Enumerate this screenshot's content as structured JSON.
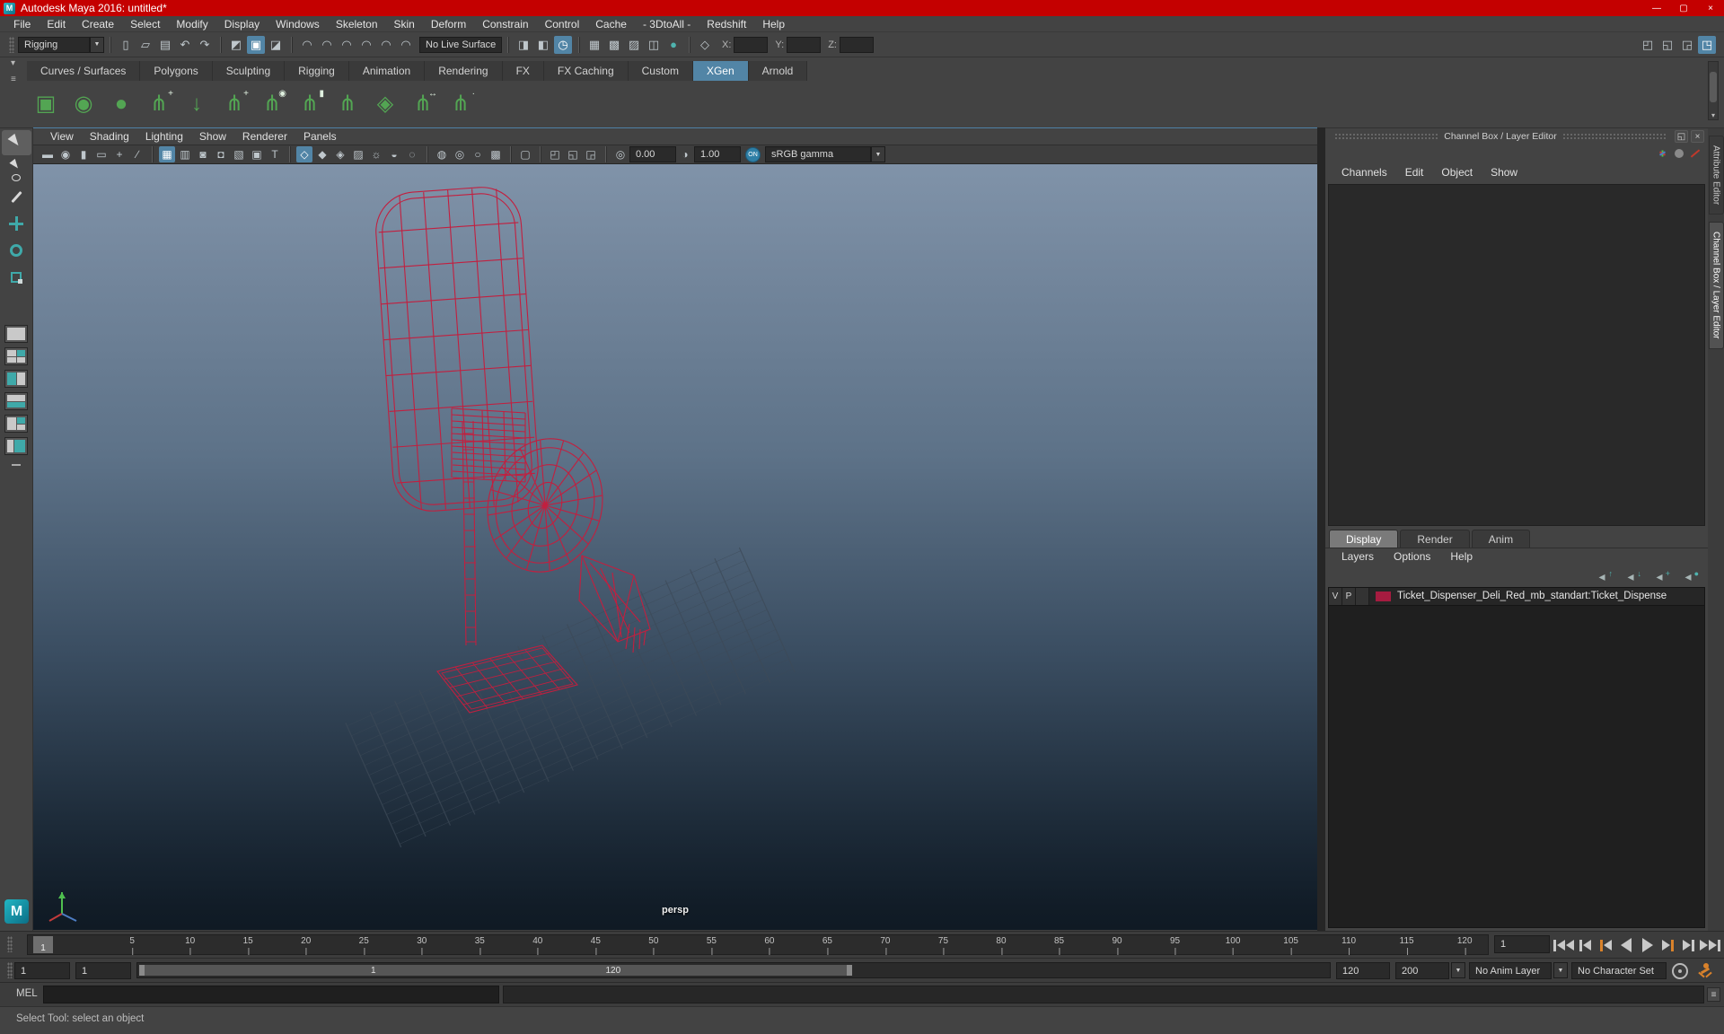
{
  "window": {
    "title": "Autodesk Maya 2016: untitled*",
    "controls": {
      "minimize": "—",
      "maximize": "▢",
      "close": "×"
    }
  },
  "icons": {
    "maya_logo": "M",
    "dropdown": "▼",
    "small_arrow": "▾",
    "shelf_menu": "≡",
    "float_window": "◱",
    "close_window": "×",
    "exposure": "◎",
    "contrast": "◑",
    "script_editor": "≡"
  },
  "menu_bar": {
    "items": [
      "File",
      "Edit",
      "Create",
      "Select",
      "Modify",
      "Display",
      "Windows",
      "Skeleton",
      "Skin",
      "Deform",
      "Constrain",
      "Control",
      "Cache",
      "- 3DtoAll -",
      "Redshift",
      "Help"
    ]
  },
  "status_line": {
    "menu_set": "Rigging",
    "live_surface_label": "No Live Surface",
    "axis_labels": {
      "x": "X:",
      "y": "Y:",
      "z": "Z:"
    },
    "icons_a": [
      {
        "n": "new-scene-icon",
        "g": "▯"
      },
      {
        "n": "open-scene-icon",
        "g": "▱"
      },
      {
        "n": "save-scene-icon",
        "g": "▤"
      },
      {
        "n": "undo-icon",
        "g": "↶"
      },
      {
        "n": "redo-icon",
        "g": "↷"
      },
      {
        "sep": true
      },
      {
        "n": "select-hierarchy-mode-icon",
        "g": "◩"
      },
      {
        "n": "select-object-mode-icon",
        "g": "▣",
        "active": true
      },
      {
        "n": "select-component-mode-icon",
        "g": "◪"
      },
      {
        "sep": true
      },
      {
        "n": "snap-to-grid-icon",
        "g": "◠"
      },
      {
        "n": "snap-to-curves-icon",
        "g": "◠"
      },
      {
        "n": "snap-to-points-icon",
        "g": "◠"
      },
      {
        "n": "snap-to-projected-center-icon",
        "g": "◠"
      },
      {
        "n": "snap-to-view-plane-icon",
        "g": "◠"
      },
      {
        "n": "make-live-icon",
        "g": "◠"
      }
    ],
    "icons_b": [
      {
        "sep": true
      },
      {
        "n": "input-connections-icon",
        "g": "◨"
      },
      {
        "n": "output-connections-icon",
        "g": "◧"
      },
      {
        "n": "construction-history-icon",
        "g": "◷",
        "active": true
      },
      {
        "sep": true
      },
      {
        "n": "render-current-frame-icon",
        "g": "▦"
      },
      {
        "n": "ipr-render-icon",
        "g": "▩"
      },
      {
        "n": "render-settings-icon",
        "g": "▨"
      },
      {
        "n": "hypershade-icon",
        "g": "◫"
      },
      {
        "n": "launch-render-view-icon",
        "g": "●",
        "teal": true
      },
      {
        "sep": true
      },
      {
        "n": "symmetry-icon",
        "g": "◇"
      }
    ],
    "icons_right": [
      {
        "n": "modeling-toolkit-icon",
        "g": "◰"
      },
      {
        "n": "attribute-editor-toggle-icon",
        "g": "◱"
      },
      {
        "n": "tool-settings-toggle-icon",
        "g": "◲"
      },
      {
        "n": "channel-box-toggle-icon",
        "g": "◳",
        "active": true
      }
    ]
  },
  "shelf": {
    "tabs": [
      "Curves / Surfaces",
      "Polygons",
      "Sculpting",
      "Rigging",
      "Animation",
      "Rendering",
      "FX",
      "FX Caching",
      "Custom",
      "XGen",
      "Arnold"
    ],
    "active_tab": "XGen",
    "icons": [
      {
        "n": "xgen-editor-icon",
        "g": "▣"
      },
      {
        "n": "xgen-update-preview-icon",
        "g": "◉"
      },
      {
        "n": "xgen-create-description-icon",
        "g": "●"
      },
      {
        "n": "xgen-add-collection-icon",
        "g": "⋔",
        "b": "+"
      },
      {
        "n": "xgen-export-selection-icon",
        "g": "↓"
      },
      {
        "n": "xgen-attach-description-icon",
        "g": "⋔",
        "b": "+"
      },
      {
        "n": "xgen-toggle-preview-icon",
        "g": "⋔",
        "b": "◉"
      },
      {
        "n": "xgen-lock-description-icon",
        "g": "⋔",
        "b": "▮"
      },
      {
        "n": "xgen-comb-tool-icon",
        "g": "⋔"
      },
      {
        "n": "xgen-patch-icon",
        "g": "◈"
      },
      {
        "n": "xgen-width-tool-icon",
        "g": "⋔",
        "b": "↔"
      },
      {
        "n": "xgen-density-tool-icon",
        "g": "⋔",
        "b": "·"
      }
    ]
  },
  "toolbox": {
    "tools": [
      "select-tool",
      "lasso-tool",
      "paint-select-tool",
      "move-tool",
      "rotate-tool",
      "scale-tool"
    ]
  },
  "viewport": {
    "menus": [
      "View",
      "Shading",
      "Lighting",
      "Show",
      "Renderer",
      "Panels"
    ],
    "toolbar": {
      "exposure_value": "0.00",
      "gamma_value": "1.00",
      "on_badge": "ON",
      "color_transform": "sRGB gamma",
      "icons": [
        {
          "n": "select-camera-icon",
          "g": "▬"
        },
        {
          "n": "camera-attributes-icon",
          "g": "◉"
        },
        {
          "n": "bookmark-icon",
          "g": "▮"
        },
        {
          "n": "image-plane-icon",
          "g": "▭"
        },
        {
          "n": "2d-pan-zoom-icon",
          "g": "+"
        },
        {
          "n": "annotate-icon",
          "g": "∕"
        },
        {
          "sep": true
        },
        {
          "n": "grid-icon",
          "g": "▦",
          "active": true
        },
        {
          "n": "film-gate-icon",
          "g": "▥"
        },
        {
          "n": "resolution-gate-icon",
          "g": "◙"
        },
        {
          "n": "gate-mask-icon",
          "g": "◘"
        },
        {
          "n": "field-chart-icon",
          "g": "▧"
        },
        {
          "n": "safe-action-icon",
          "g": "▣"
        },
        {
          "n": "safe-title-icon",
          "g": "T"
        },
        {
          "sep": true
        },
        {
          "n": "wireframe-icon",
          "g": "◇",
          "active": true
        },
        {
          "n": "smooth-shade-icon",
          "g": "◆"
        },
        {
          "n": "wireframe-on-shaded-icon",
          "g": "◈"
        },
        {
          "n": "textured-icon",
          "g": "▨"
        },
        {
          "n": "use-all-lights-icon",
          "g": "☼"
        },
        {
          "n": "shadows-icon",
          "g": "◒"
        },
        {
          "n": "ambient-occlusion-icon",
          "g": "◌"
        },
        {
          "sep": true
        },
        {
          "n": "default-material-icon",
          "g": "◍"
        },
        {
          "n": "color-chart-icon",
          "g": "◎"
        },
        {
          "n": "gamma-circle-icon",
          "g": "○"
        },
        {
          "n": "background-toggle-icon",
          "g": "▩"
        },
        {
          "sep": true
        },
        {
          "n": "isolate-select-icon",
          "g": "▢"
        },
        {
          "sep": true
        },
        {
          "n": "pane-layout-icon",
          "g": "◰"
        },
        {
          "n": "pane-swap-icon",
          "g": "◱"
        },
        {
          "n": "snapshot-icon",
          "g": "◲"
        },
        {
          "sep": true
        }
      ]
    },
    "camera_label": "persp"
  },
  "channel_box": {
    "panel_title": "Channel Box / Layer Editor",
    "menus": [
      "Channels",
      "Edit",
      "Object",
      "Show"
    ],
    "side_tabs": [
      {
        "label": "Attribute Editor",
        "active": false
      },
      {
        "label": "Channel Box / Layer Editor",
        "active": true
      }
    ]
  },
  "layer_editor": {
    "tabs": [
      "Display",
      "Render",
      "Anim"
    ],
    "active_tab": "Display",
    "menus": [
      "Layers",
      "Options",
      "Help"
    ],
    "icons": [
      {
        "n": "layer-move-up-icon",
        "g": "◂",
        "b": "↑"
      },
      {
        "n": "layer-move-down-icon",
        "g": "◂",
        "b": "↓"
      },
      {
        "n": "layer-create-icon",
        "g": "◂",
        "b": "+"
      },
      {
        "n": "layer-create-from-selected-icon",
        "g": "◂",
        "b": "●"
      }
    ],
    "layers": [
      {
        "visibility": "V",
        "playback": "P",
        "color": "#a61c40",
        "name": "Ticket_Dispenser_Deli_Red_mb_standart:Ticket_Dispense"
      }
    ]
  },
  "time_slider": {
    "current_frame": "1",
    "tick_labels": [
      5,
      10,
      15,
      20,
      25,
      30,
      35,
      40,
      45,
      50,
      55,
      60,
      65,
      70,
      75,
      80,
      85,
      90,
      95,
      100,
      105,
      110,
      115,
      120
    ],
    "current_time_field": "1",
    "playback_buttons": [
      "go-to-start",
      "step-back-key",
      "step-back-frame",
      "play-backwards",
      "play-forward",
      "step-forward-frame",
      "step-forward-key",
      "go-to-end"
    ]
  },
  "range_slider": {
    "anim_start": "1",
    "playback_start": "1",
    "handle_start_label": "1",
    "handle_end_label": "120",
    "playback_end": "120",
    "anim_end": "200",
    "anim_layer": "No Anim Layer",
    "character_set": "No Character Set"
  },
  "command_line": {
    "label": "MEL"
  },
  "help_line": {
    "message": "Select Tool: select an object"
  },
  "colors": {
    "titlebar": "#c40000",
    "accent_blue": "#5285a6",
    "shelf_green": "#53a553",
    "wireframe_red": "#c21f3f",
    "layer_swatch": "#a61c40",
    "icon_teal": "#4fb3ae",
    "orange": "#d9822b"
  }
}
